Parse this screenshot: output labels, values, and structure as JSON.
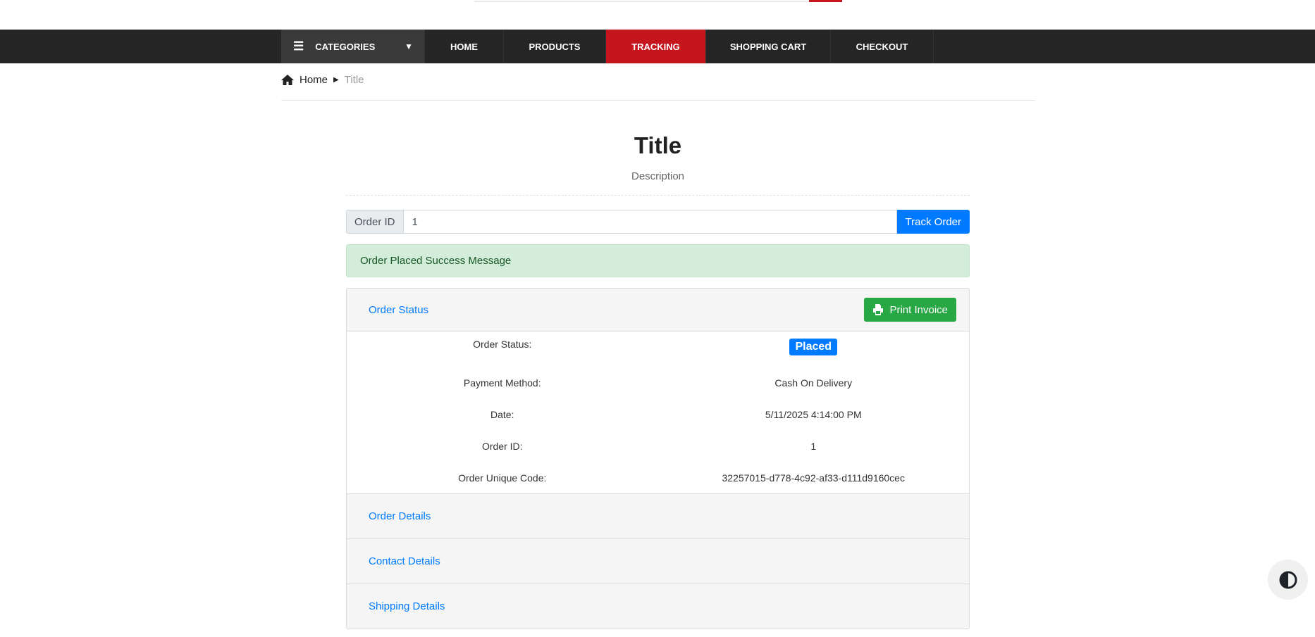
{
  "nav": {
    "categories": "CATEGORIES",
    "items": [
      "HOME",
      "PRODUCTS",
      "TRACKING",
      "SHOPPING CART",
      "CHECKOUT"
    ],
    "active": "TRACKING"
  },
  "breadcrumb": {
    "home": "Home",
    "current": "Title"
  },
  "page": {
    "title": "Title",
    "description": "Description"
  },
  "tracking": {
    "label": "Order ID",
    "value": "1",
    "button": "Track Order"
  },
  "alert": "Order Placed Success Message",
  "card": {
    "status_header": "Order Status",
    "print_button": "Print Invoice",
    "rows": [
      {
        "label": "Order Status:",
        "value": "Placed"
      },
      {
        "label": "Payment Method:",
        "value": "Cash On Delivery"
      },
      {
        "label": "Date:",
        "value": "5/11/2025 4:14:00 PM"
      },
      {
        "label": "Order ID:",
        "value": "1"
      },
      {
        "label": "Order Unique Code:",
        "value": "32257015-d778-4c92-af33-d111d9160cec"
      }
    ],
    "sections": [
      "Order Details",
      "Contact Details",
      "Shipping Details"
    ]
  },
  "colors": {
    "nav": "#252525",
    "active": "#c4161c",
    "primary": "#007bff",
    "success": "#28a745"
  }
}
